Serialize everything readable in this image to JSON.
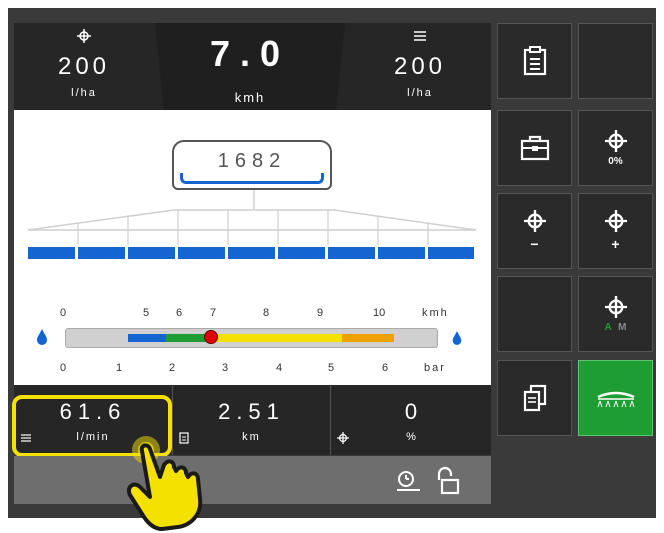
{
  "top_left": {
    "value": "200",
    "unit": "l/ha"
  },
  "speed": {
    "value": "7.0",
    "unit": "kmh"
  },
  "top_right": {
    "value": "200",
    "unit": "l/ha"
  },
  "tank": {
    "value": "1682"
  },
  "scale": {
    "speed_ticks": [
      "0",
      "5",
      "6",
      "7",
      "8",
      "9",
      "10"
    ],
    "speed_unit": "kmh",
    "pressure_ticks": [
      "0",
      "1",
      "2",
      "3",
      "4",
      "5",
      "6"
    ],
    "pressure_unit": "bar"
  },
  "bottom": {
    "flow": {
      "value": "61.6",
      "unit": "l/min"
    },
    "distance": {
      "value": "2.51",
      "unit": "km"
    },
    "percent": {
      "value": "0",
      "unit": "%"
    }
  },
  "side": {
    "rate_percent": "0%",
    "rate_minus": "−",
    "rate_plus": "+",
    "mode_a": "A",
    "mode_m": "M"
  },
  "colors": {
    "boom_blue": "#1464d2",
    "active_green": "#1e9e32",
    "highlight_yellow": "#f5e100"
  },
  "icons": [
    "target-icon",
    "clipboard-icon",
    "briefcase-icon",
    "copy-icon",
    "boom-icon",
    "timer-icon",
    "unlock-icon",
    "hand-pointer-icon"
  ]
}
